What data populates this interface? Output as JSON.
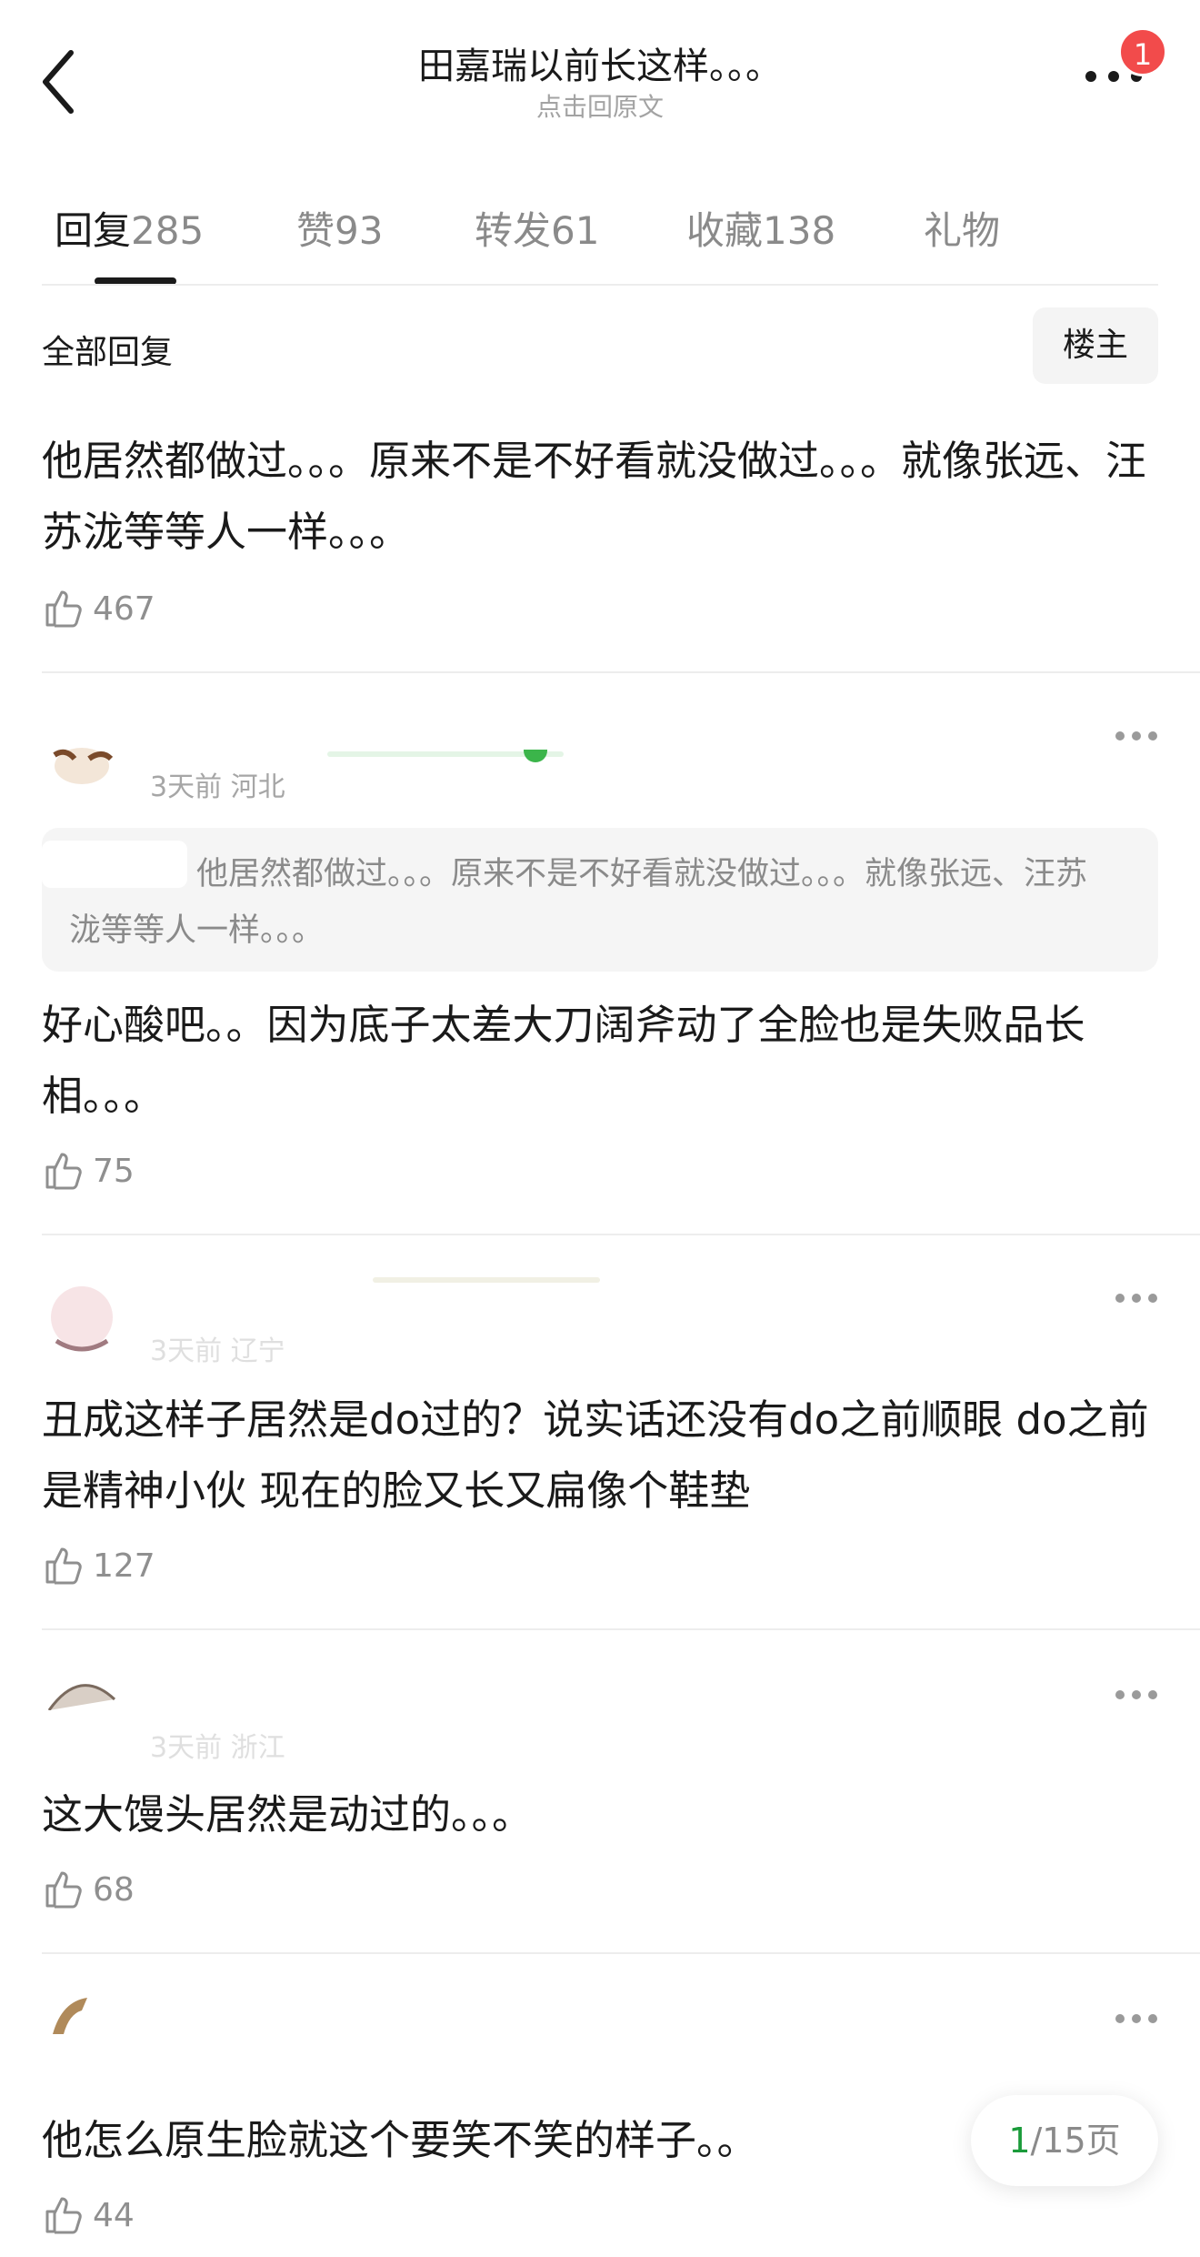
{
  "header": {
    "title": "田嘉瑞以前长这样。。。",
    "subtitle": "点击回原文",
    "notification_count": "1"
  },
  "tabs": [
    {
      "label": "回复",
      "count": "285",
      "active": true
    },
    {
      "label": "赞",
      "count": "93",
      "active": false
    },
    {
      "label": "转发",
      "count": "61",
      "active": false
    },
    {
      "label": "收藏",
      "count": "138",
      "active": false
    },
    {
      "label": "礼物",
      "count": "",
      "active": false
    }
  ],
  "section": {
    "title": "全部回复",
    "op_button": "楼主"
  },
  "comments": [
    {
      "meta": "",
      "quote_text": "",
      "text": "他居然都做过。。。原来不是不好看就没做过。。。就像张远、汪苏泷等等人一样。。。",
      "likes": "467"
    },
    {
      "meta": "3天前 河北",
      "quote_text": "他居然都做过。。。原来不是不好看就没做过。。。就像张远、汪苏泷等等人一样。。。",
      "text": "好心酸吧。。因为底子太差大刀阔斧动了全脸也是失败品长相。。。",
      "likes": "75"
    },
    {
      "meta": "3天前 辽宁",
      "quote_text": "",
      "text": "丑成这样子居然是do过的？说实话还没有do之前顺眼 do之前是精神小伙 现在的脸又长又扁像个鞋垫",
      "likes": "127"
    },
    {
      "meta": "3天前 浙江",
      "quote_text": "",
      "text": "这大馒头居然是动过的。。。",
      "likes": "68"
    },
    {
      "meta": "",
      "quote_text": "",
      "text": "他怎么原生脸就这个要笑不笑的样子。。",
      "likes": "44"
    }
  ],
  "pager": {
    "current": "1",
    "total_text": "/15页"
  },
  "colors": {
    "accent_green": "#1a9b3a",
    "badge_red": "#f24b4b"
  },
  "icons": [
    "back-arrow-icon",
    "more-icon",
    "thumbs-up-icon"
  ]
}
